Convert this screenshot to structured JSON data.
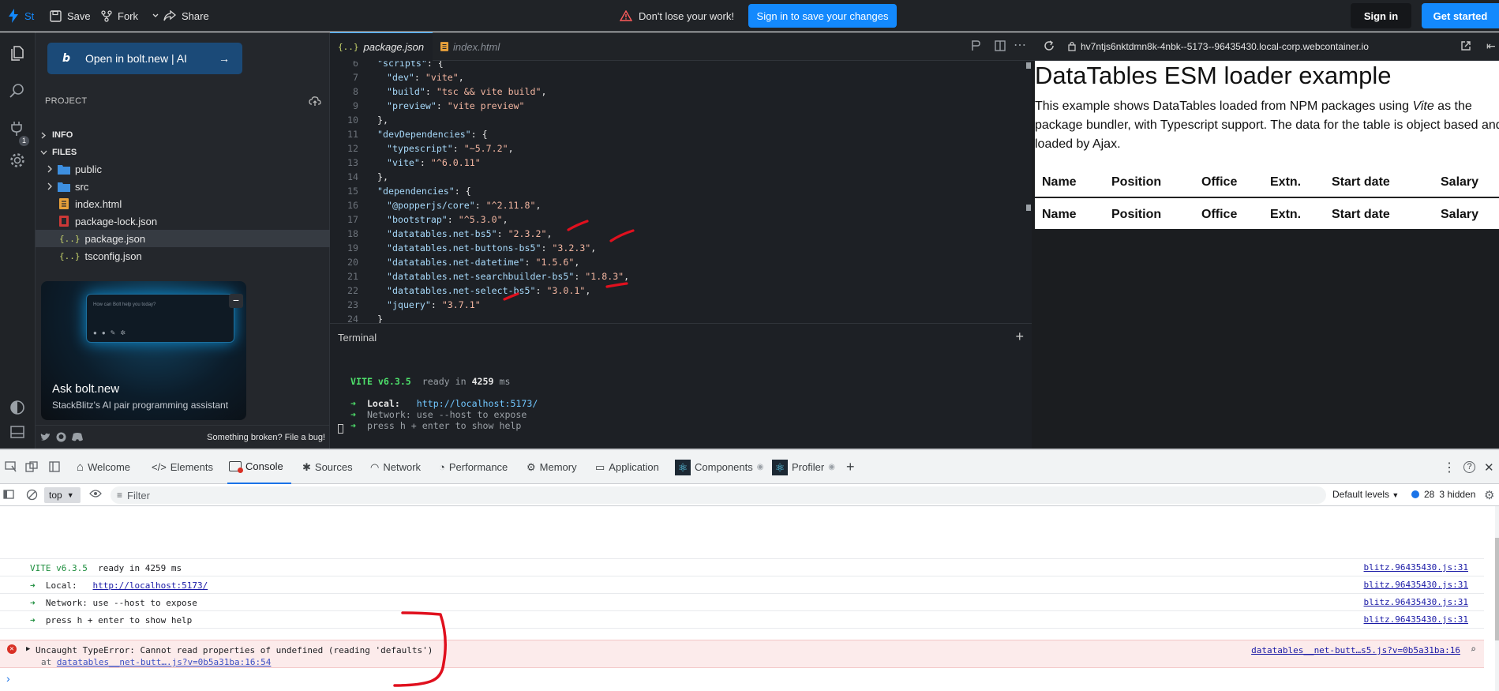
{
  "topbar": {
    "save": "Save",
    "fork": "Fork",
    "share": "Share",
    "warning": "Don't lose your work!",
    "signin_save": "Sign in to save your changes",
    "signin": "Sign in",
    "get_started": "Get started",
    "logo": "St"
  },
  "activity": {
    "badge": "1"
  },
  "sidebar": {
    "open_bolt": "Open in bolt.new | AI",
    "project": "PROJECT",
    "info": "INFO",
    "files": "FILES",
    "tree": [
      "public",
      "src",
      "index.html",
      "package-lock.json",
      "package.json",
      "tsconfig.json"
    ],
    "ask_prompt": "How can Bolt help you today?",
    "ask_title": "Ask bolt.new",
    "ask_sub": "StackBlitz's AI pair programming assistant",
    "broken": "Something broken? File a bug!"
  },
  "editor": {
    "tabs": [
      "package.json",
      "index.html"
    ],
    "lines": [
      {
        "n": "6",
        "key": "\"scripts\"",
        "val": ": {",
        "indent": 1
      },
      {
        "n": "7",
        "key": "\"dev\"",
        "val": ": ",
        "str": "\"vite\"",
        "end": ",",
        "indent": 2
      },
      {
        "n": "8",
        "key": "\"build\"",
        "val": ": ",
        "str": "\"tsc && vite build\"",
        "end": ",",
        "indent": 2
      },
      {
        "n": "9",
        "key": "\"preview\"",
        "val": ": ",
        "str": "\"vite preview\"",
        "end": "",
        "indent": 2
      },
      {
        "n": "10",
        "key": "",
        "val": "},",
        "indent": 1
      },
      {
        "n": "11",
        "key": "\"devDependencies\"",
        "val": ": {",
        "indent": 1
      },
      {
        "n": "12",
        "key": "\"typescript\"",
        "val": ": ",
        "str": "\"~5.7.2\"",
        "end": ",",
        "indent": 2
      },
      {
        "n": "13",
        "key": "\"vite\"",
        "val": ": ",
        "str": "\"^6.0.11\"",
        "end": "",
        "indent": 2
      },
      {
        "n": "14",
        "key": "",
        "val": "},",
        "indent": 1
      },
      {
        "n": "15",
        "key": "\"dependencies\"",
        "val": ": {",
        "indent": 1
      },
      {
        "n": "16",
        "key": "\"@popperjs/core\"",
        "val": ": ",
        "str": "\"^2.11.8\"",
        "end": ",",
        "indent": 2
      },
      {
        "n": "17",
        "key": "\"bootstrap\"",
        "val": ": ",
        "str": "\"^5.3.0\"",
        "end": ",",
        "indent": 2
      },
      {
        "n": "18",
        "key": "\"datatables.net-bs5\"",
        "val": ": ",
        "str": "\"2.3.2\"",
        "end": ",",
        "indent": 2
      },
      {
        "n": "19",
        "key": "\"datatables.net-buttons-bs5\"",
        "val": ": ",
        "str": "\"3.2.3\"",
        "end": ",",
        "indent": 2
      },
      {
        "n": "20",
        "key": "\"datatables.net-datetime\"",
        "val": ": ",
        "str": "\"1.5.6\"",
        "end": ",",
        "indent": 2
      },
      {
        "n": "21",
        "key": "\"datatables.net-searchbuilder-bs5\"",
        "val": ": ",
        "str": "\"1.8.3\"",
        "end": ",",
        "indent": 2
      },
      {
        "n": "22",
        "key": "\"datatables.net-select-bs5\"",
        "val": ": ",
        "str": "\"3.0.1\"",
        "end": ",",
        "indent": 2
      },
      {
        "n": "23",
        "key": "\"jquery\"",
        "val": ": ",
        "str": "\"3.7.1\"",
        "end": "",
        "indent": 2
      },
      {
        "n": "24",
        "key": "",
        "val": "}",
        "indent": 1
      }
    ]
  },
  "terminal": {
    "title": "Terminal",
    "vite": "VITE v6.3.5",
    "ready": "ready in",
    "ms": "4259",
    "ms_unit": "ms",
    "local_label": "Local:",
    "local_url": "http://localhost:5173/",
    "network": "Network: use --host to expose",
    "help": "press h + enter to show help"
  },
  "preview": {
    "url": "hv7ntjs6nktdmn8k-4nbk--5173--96435430.local-corp.webcontainer.io",
    "title": "DataTables ESM loader example",
    "desc_pre": "This example shows DataTables loaded from NPM packages using ",
    "desc_em": "Vite",
    "desc_post": " as the package bundler, with Typescript support. The data for the table is object based and loaded by Ajax.",
    "columns": [
      "Name",
      "Position",
      "Office",
      "Extn.",
      "Start date",
      "Salary"
    ]
  },
  "devtools": {
    "tabs": [
      "Welcome",
      "Elements",
      "Console",
      "Sources",
      "Network",
      "Performance",
      "Memory",
      "Application",
      "Components",
      "Profiler"
    ],
    "context": "top",
    "filter": "Filter",
    "levels": "Default levels",
    "count": "28",
    "hidden": "3 hidden",
    "console": [
      {
        "msg": "VITE v6.3.5  ready in 4259 ms",
        "src": "blitz.96435430.js:31"
      },
      {
        "msg": "➜  Local:   http://localhost:5173/",
        "src": "blitz.96435430.js:31"
      },
      {
        "msg": "➜  Network: use --host to expose",
        "src": "blitz.96435430.js:31"
      },
      {
        "msg": "➜  press h + enter to show help",
        "src": "blitz.96435430.js:31"
      }
    ],
    "error": "Uncaught TypeError: Cannot read properties of undefined (reading 'defaults')",
    "error_at": "at",
    "error_at_link": "datatables__net-butt….js?v=0b5a31ba:16:54",
    "error_src": "datatables__net-butt…s5.js?v=0b5a31ba:16"
  },
  "colors": {
    "accent": "#1389fd",
    "annotation": "#e0101e",
    "error_bg": "#fcebeb"
  }
}
